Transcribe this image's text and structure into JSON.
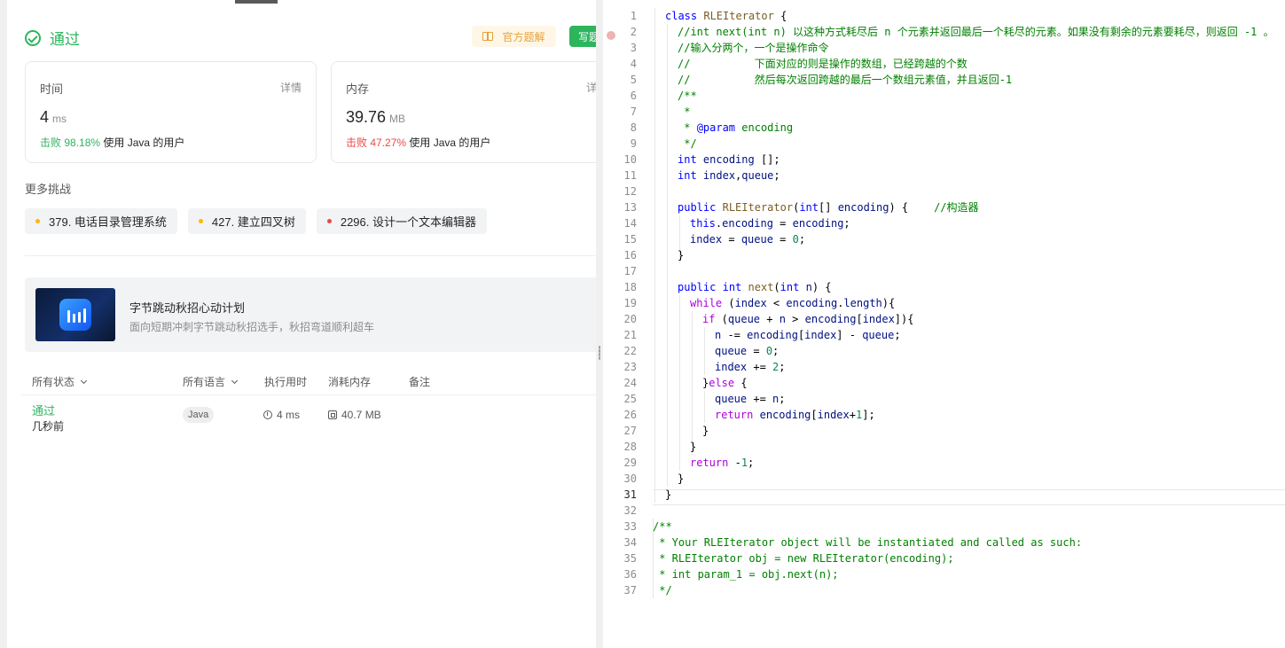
{
  "result": {
    "status": "通过",
    "solution_button": "官方题解",
    "write_button": "写题解"
  },
  "cards": {
    "time": {
      "label": "时间",
      "detail": "详情",
      "value": "4",
      "unit": "ms",
      "beat_prefix": "击败",
      "beat_pct": "98.18%",
      "beat_suffix": "使用 Java 的用户"
    },
    "memory": {
      "label": "内存",
      "detail": "详情",
      "value": "39.76",
      "unit": "MB",
      "beat_prefix": "击败",
      "beat_pct": "47.27%",
      "beat_suffix": "使用 Java 的用户"
    }
  },
  "more": {
    "title": "更多挑战",
    "items": [
      {
        "label": "379. 电话目录管理系统",
        "color": "#ffb800"
      },
      {
        "label": "427. 建立四叉树",
        "color": "#ffb800"
      },
      {
        "label": "2296. 设计一个文本编辑器",
        "color": "#ef4743"
      }
    ]
  },
  "banner": {
    "title": "字节跳动秋招心动计划",
    "subtitle": "面向短期冲刺字节跳动秋招选手，秋招弯道顺利超车"
  },
  "submissions": {
    "headers": {
      "status": "所有状态",
      "language": "所有语言",
      "runtime": "执行用时",
      "memory": "消耗内存",
      "notes": "备注"
    },
    "rows": [
      {
        "status": "通过",
        "when": "几秒前",
        "language": "Java",
        "runtime": "4 ms",
        "memory": "40.7 MB"
      }
    ]
  },
  "code": {
    "lines": [
      "class RLEIterator {",
      "//int next(int n) 以这种方式耗尽后 n 个元素并返回最后一个耗尽的元素。如果没有剩余的元素要耗尽，则返回 -1 。",
      "//输入分两个，一个是操作命令",
      "//          下面对应的则是操作的数组，已经跨越的个数",
      "//          然后每次返回跨越的最后一个数组元素值，并且返回-1",
      "/**",
      " *",
      " * @param encoding",
      " */",
      "int encoding [];",
      "int index,queue;",
      "",
      "public RLEIterator(int[] encoding) {    //构造器",
      "this.encoding = encoding;",
      "index = queue = 0;",
      "}",
      "",
      "public int next(int n) {",
      "while (index < encoding.length){",
      "if (queue + n > encoding[index]){",
      "n -= encoding[index] - queue;",
      "queue = 0;",
      "index += 2;",
      "}else {",
      "queue += n;",
      "return encoding[index+1];",
      "}",
      "}",
      "return -1;",
      "}",
      "}",
      "",
      "/**",
      " * Your RLEIterator object will be instantiated and called as such:",
      " * RLEIterator obj = new RLEIterator(encoding);",
      " * int param_1 = obj.next(n);",
      " */"
    ]
  },
  "colors": {
    "accent_green": "#2db55d",
    "danger_red": "#ef4743",
    "warning_orange": "#e6a23c"
  }
}
